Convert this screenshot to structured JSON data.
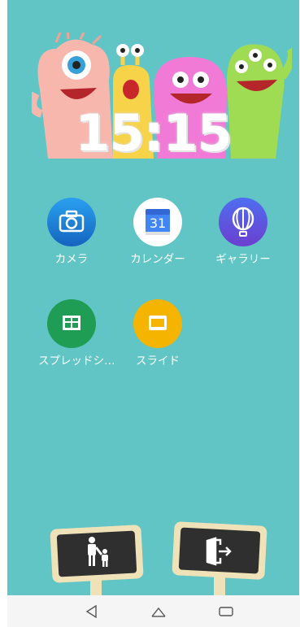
{
  "clock": {
    "time": "15:15"
  },
  "apps": [
    {
      "label": "カメラ",
      "icon": "camera-icon"
    },
    {
      "label": "カレンダー",
      "icon": "calendar-icon",
      "date": "31"
    },
    {
      "label": "ギャラリー",
      "icon": "gallery-balloon-icon"
    },
    {
      "label": "スプレッドシ…",
      "icon": "spreadsheet-icon"
    },
    {
      "label": "スライド",
      "icon": "slides-icon"
    }
  ],
  "signs": [
    {
      "icon": "parent-child-icon"
    },
    {
      "icon": "exit-door-icon"
    }
  ],
  "navbar": {
    "buttons": [
      "back-icon",
      "home-icon",
      "recents-icon"
    ]
  },
  "colors": {
    "background": "#61c5c5",
    "camera": "#1e88e5",
    "calendar": "#ffffff",
    "gallery": "#5a52d6",
    "sheets": "#1f9d55",
    "slides": "#f5b400",
    "sign_board": "#2f2f2f",
    "sign_frame": "#efe2b8"
  }
}
